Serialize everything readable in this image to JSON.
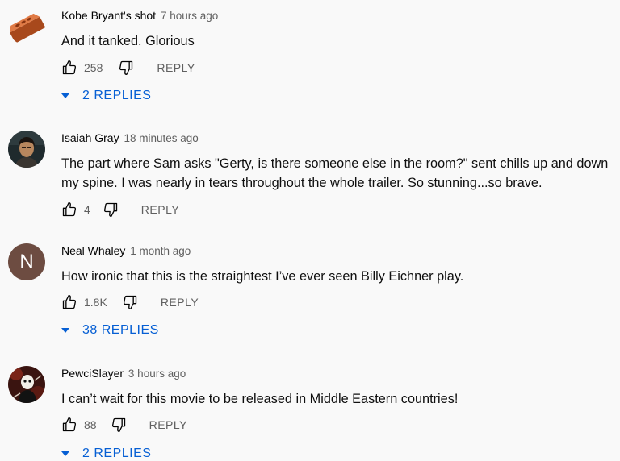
{
  "comments": [
    {
      "author": "Kobe Bryant's shot",
      "time": "7 hours ago",
      "text": "And it tanked. Glorious",
      "likes": "258",
      "reply_label": "REPLY",
      "replies_label": "2 REPLIES",
      "avatar_icon": "brick-icon"
    },
    {
      "author": "Isaiah Gray",
      "time": "18 minutes ago",
      "text": "The part where Sam asks \"Gerty, is there someone else in the room?\" sent chills up and down my spine. I was nearly in tears throughout the whole trailer. So stunning...so brave.",
      "likes": "4",
      "reply_label": "REPLY",
      "avatar_icon": "person-photo-icon"
    },
    {
      "author": "Neal Whaley",
      "time": "1 month ago",
      "text": "How ironic that this is the straightest I’ve ever seen Billy Eichner play.",
      "likes": "1.8K",
      "reply_label": "REPLY",
      "replies_label": "38 REPLIES",
      "avatar_letter": "N",
      "avatar_color": "#6d4c41"
    },
    {
      "author": "PewciSlayer",
      "time": "3 hours ago",
      "text": "I can’t wait for this movie to be released in Middle Eastern countries!",
      "likes": "88",
      "reply_label": "REPLY",
      "replies_label": "2 REPLIES",
      "avatar_icon": "dark-figure-photo-icon"
    }
  ],
  "colors": {
    "link_blue": "#065fd4",
    "meta_gray": "#606060",
    "background": "#f9f9f9"
  }
}
